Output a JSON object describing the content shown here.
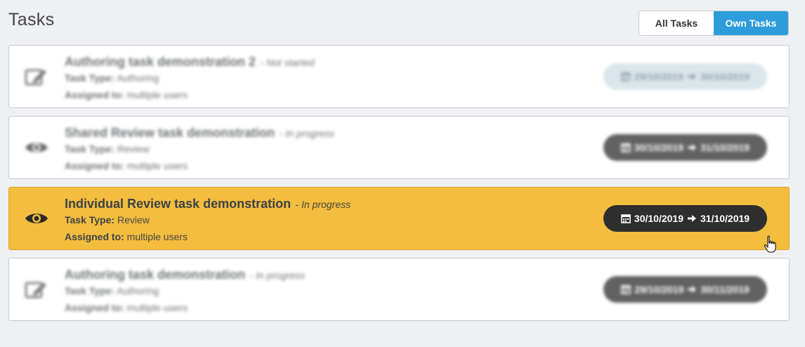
{
  "page": {
    "title": "Tasks"
  },
  "filters": {
    "all_label": "All Tasks",
    "own_label": "Own Tasks",
    "active": "own"
  },
  "tasks": [
    {
      "title": "Authoring task demonstration 2",
      "status": "- Not started",
      "type_label": "Task Type:",
      "type": "Authoring",
      "assigned_label": "Assigned to:",
      "assigned": "multiple users",
      "start": "29/10/2019",
      "end": "30/10/2019",
      "icon": "edit-icon",
      "blurred": true
    },
    {
      "title": "Shared Review task demonstration",
      "status": "- In progress",
      "type_label": "Task Type:",
      "type": "Review",
      "assigned_label": "Assigned to:",
      "assigned": "multiple users",
      "start": "30/10/2019",
      "end": "31/10/2019",
      "icon": "eye-icon",
      "blurred": true
    },
    {
      "title": "Individual Review task demonstration",
      "status": "- In progress",
      "type_label": "Task Type:",
      "type": "Review",
      "assigned_label": "Assigned to:",
      "assigned": "multiple users",
      "start": "30/10/2019",
      "end": "31/10/2019",
      "icon": "eye-icon",
      "blurred": false,
      "highlighted": true
    },
    {
      "title": "Authoring task demonstration",
      "status": "- In progress",
      "type_label": "Task Type:",
      "type": "Authoring",
      "assigned_label": "Assigned to:",
      "assigned": "multiple users",
      "start": "29/10/2019",
      "end": "30/11/2019",
      "icon": "edit-icon",
      "blurred": true
    }
  ],
  "colors": {
    "highlight": "#f3bd3e",
    "active_filter": "#2d9cdb",
    "date_pill": "#2e2e2e",
    "date_pill_pale": "#cfdde3"
  }
}
